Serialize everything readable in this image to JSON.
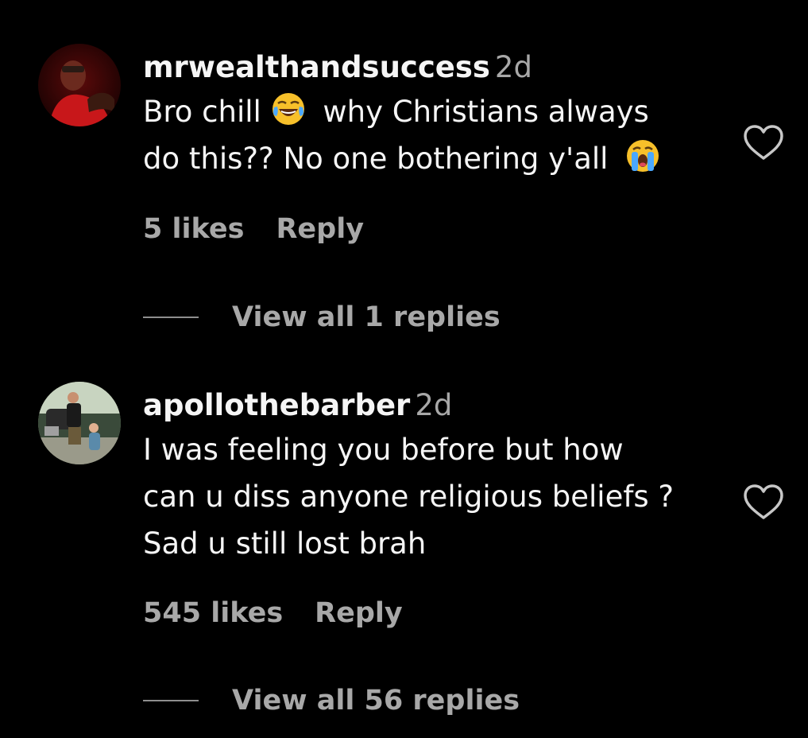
{
  "comments": [
    {
      "username": "mrwealthandsuccess",
      "time": "2d",
      "text_part1": "Bro chill",
      "emoji1": "face-with-tears-of-joy-icon",
      "text_part2": "why Christians always",
      "text_part3": "do this?? No one bothering y'all",
      "emoji2": "loudly-crying-face-icon",
      "likes": "5 likes",
      "reply_label": "Reply",
      "view_replies": "View all 1 replies"
    },
    {
      "username": "apollothebarber",
      "time": "2d",
      "text_line1": "I was feeling you before but how",
      "text_line2": "can u diss anyone religious beliefs ?",
      "text_line3": "Sad u still lost brah",
      "likes": "545 likes",
      "reply_label": "Reply",
      "view_replies": "View all 56 replies"
    }
  ],
  "colors": {
    "background": "#000000",
    "primary_text": "#f5f5f5",
    "secondary_text": "#a8a8a8"
  }
}
